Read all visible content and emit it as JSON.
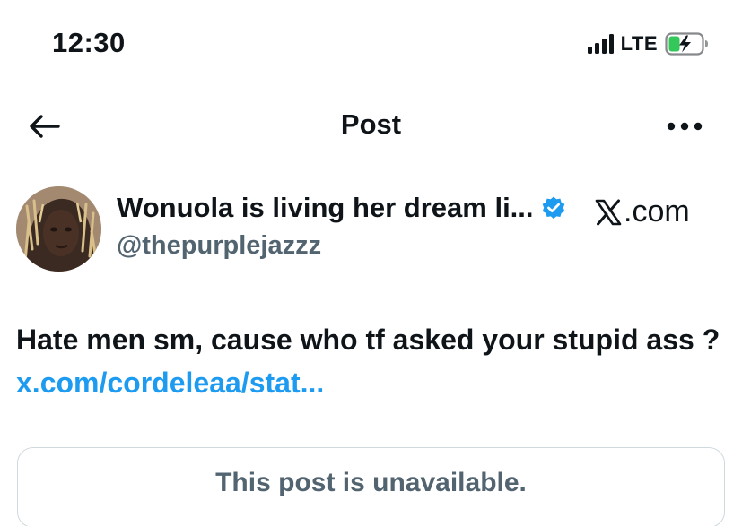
{
  "status_bar": {
    "time": "12:30",
    "network": "LTE",
    "icons": [
      "signal-icon",
      "battery-charging-icon"
    ]
  },
  "header": {
    "title": "Post",
    "back_icon": "arrow-left-icon",
    "more_icon": "more-horizontal-icon"
  },
  "post": {
    "author": {
      "display_name": "Wonuola is living her dream li...",
      "handle": "@thepurplejazzz",
      "verified": true,
      "verified_icon": "verified-badge-icon"
    },
    "source": {
      "label": ".com",
      "logo_icon": "x-logo-icon"
    },
    "text": "Hate men sm, cause who tf asked your stupid ass ? ",
    "link_text": "x.com/cordeleaa/stat...",
    "quoted_post": {
      "message": "This post is unavailable."
    }
  },
  "colors": {
    "accent_link": "#1d9bf0",
    "verified_badge": "#1d9bf0",
    "battery_charge": "#34c759",
    "secondary_text": "#536471",
    "primary_text": "#0f1419",
    "card_border": "#cfd9de"
  }
}
